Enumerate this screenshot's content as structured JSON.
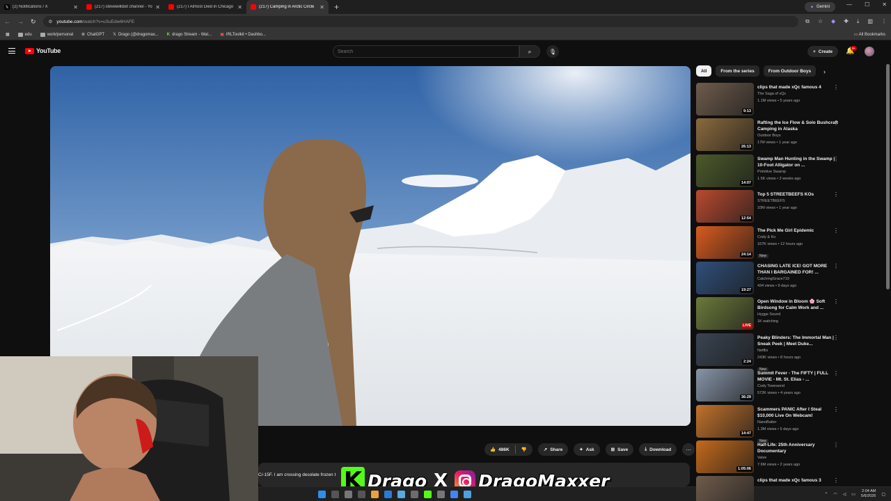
{
  "browser": {
    "tabs": [
      {
        "title": "(2) Notifications / X",
        "icon": "x-icon",
        "color": "#000000"
      },
      {
        "title": "(217) stevewilldoit channel - Yo",
        "icon": "youtube-icon",
        "color": "#ff0000"
      },
      {
        "title": "(217) I Almost Died in Chicago",
        "icon": "youtube-icon",
        "color": "#ff0000"
      },
      {
        "title": "(217) Camping in Arctic Circle",
        "icon": "youtube-icon",
        "color": "#ff0000"
      }
    ],
    "new_tab": "+",
    "gemini_label": "Gemini",
    "url_host": "youtube.com",
    "url_path": "/watch?v=uSuEdw6HAFE",
    "bookmarks": [
      "edu",
      "work/personal",
      "ChatGPT",
      "Drago (@dragomax...",
      "drago Stream - Wat...",
      "IRLToolkit • Dashbo..."
    ],
    "all_bookmarks": "All Bookmarks"
  },
  "youtube": {
    "logo_text": "YouTube",
    "search_placeholder": "Search",
    "create_label": "Create",
    "notification_badge": "9+"
  },
  "video": {
    "like_count": "486K",
    "share_label": "Share",
    "ask_label": "Ask",
    "save_label": "Save",
    "download_label": "Download",
    "description_snippet": "C/-15F. I am crossing desolate frozen t"
  },
  "overlay": {
    "kick_letter": "K",
    "kick_name": "Drago",
    "x_letter": "X",
    "ig_name": "DragoMaxxer"
  },
  "chips": [
    "All",
    "From the series",
    "From Outdoor Boys"
  ],
  "recommendations": [
    {
      "title": "clips that made xQc famous 4",
      "channel": "The Saga of xQc",
      "meta": "1.1M views • 5 years ago",
      "duration": "9:13",
      "thumb": "#6f5c4c",
      "new": ""
    },
    {
      "title": "Rafting the Ice Flow & Solo Bushcraft Camping in Alaska",
      "channel": "Outdoor Boys",
      "meta": "17M views • 1 year ago",
      "duration": "26:13",
      "thumb": "#8a6a3d",
      "new": ""
    },
    {
      "title": "Swamp Man Hunting in the Swamp | 10-Foot Alligator on ...",
      "channel": "Primitive Swamp",
      "meta": "1.5K views • 2 weeks ago",
      "duration": "14:07",
      "thumb": "#4b5a2a",
      "new": ""
    },
    {
      "title": "Top 5 STREETBEEFS KOs",
      "channel": "STREETBEEFS",
      "meta": "10M views • 1 year ago",
      "duration": "12:54",
      "thumb": "#b94a2f",
      "new": ""
    },
    {
      "title": "The Pick Me Girl Epidemic",
      "channel": "Cody & Ko",
      "meta": "167K views • 12 hours ago",
      "duration": "24:14",
      "thumb": "#d95b1f",
      "new": "New"
    },
    {
      "title": "CHASING LATE ICE! GOT MORE THAN I BARGAINED FOR! ...",
      "channel": "CatchingGrace719",
      "meta": "434 views • 9 days ago",
      "duration": "19:27",
      "thumb": "#2f4f7a",
      "new": ""
    },
    {
      "title": "Open Window in Bloom 🌸 Soft Birdsong for Calm Work and ...",
      "channel": "Hygge Sound",
      "meta": "1K watching",
      "duration": "LIVE",
      "thumb": "#6b7a3a",
      "new": ""
    },
    {
      "title": "Peaky Blinders: The Immortal Man | Sneak Peek | Meet Duke...",
      "channel": "Netflix",
      "meta": "243K views • 8 hours ago",
      "duration": "2:24",
      "thumb": "#3a4452",
      "new": "New"
    },
    {
      "title": "Summit Fever - The FIFTY | FULL MOVIE - Mt. St. Elias - ...",
      "channel": "Cody Townsend",
      "meta": "572K views • 4 years ago",
      "duration": "36:29",
      "thumb": "#8795a8",
      "new": ""
    },
    {
      "title": "Scammers PANIC After I Steal $10,000 Live On Webcam!",
      "channel": "NanoBaiter",
      "meta": "1.3M views • 5 days ago",
      "duration": "14:47",
      "thumb": "#c2722c",
      "new": "New"
    },
    {
      "title": "Half-Life: 25th Anniversary Documentary",
      "channel": "Valve",
      "meta": "7.6M views • 2 years ago",
      "duration": "1:05:06",
      "thumb": "#c46a1c",
      "new": ""
    },
    {
      "title": "clips that made xQc famous 3",
      "channel": "",
      "meta": "",
      "duration": "",
      "thumb": "#6f5c4c",
      "new": ""
    }
  ],
  "taskbar": {
    "time": "2:04 AM",
    "date": "5/6/2026"
  }
}
